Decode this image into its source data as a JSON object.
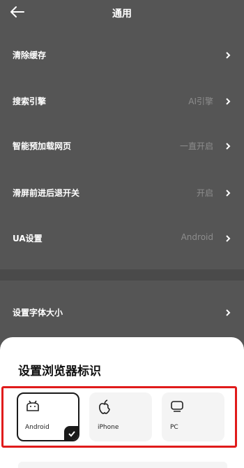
{
  "header": {
    "title": "通用"
  },
  "settings": [
    {
      "label": "清除缓存",
      "value": ""
    },
    {
      "label": "搜索引擎",
      "value": "AI引擎"
    },
    {
      "label": "智能预加载网页",
      "value": "一直开启"
    },
    {
      "label": "滑屏前进后退开关",
      "value": "开启"
    },
    {
      "label": "UA设置",
      "value": "Android"
    },
    {
      "label": "设置字体大小",
      "value": ""
    }
  ],
  "sheet": {
    "title": "设置浏览器标识",
    "options": [
      {
        "name": "Android",
        "icon": "android-icon",
        "selected": true
      },
      {
        "name": "iPhone",
        "icon": "apple-icon",
        "selected": false
      },
      {
        "name": "PC",
        "icon": "monitor-icon",
        "selected": false
      }
    ]
  },
  "colors": {
    "overlay_bg": "#555555",
    "highlight": "#e01b1b",
    "selected_border": "#1a1a1a"
  }
}
